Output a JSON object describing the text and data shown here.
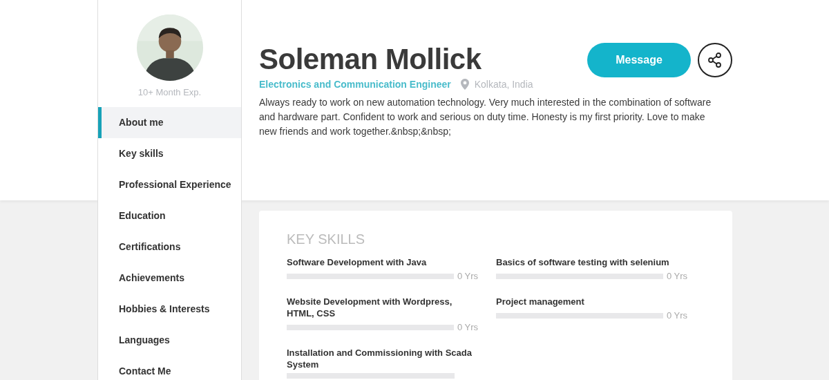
{
  "profile": {
    "experience": "10+ Month Exp.",
    "name": "Soleman Mollick",
    "title": "Electronics and Communication Engineer",
    "location": "Kolkata, India",
    "bio": "Always ready to work on new automation technology. Very much interested in the combination of software and hardware part. Confident to work and serious on duty time. Honesty is my first priority. Love to make new friends and work together.&nbsp;&nbsp;",
    "message_button": "Message"
  },
  "sidebar": {
    "items": [
      {
        "label": "About me",
        "selected": true
      },
      {
        "label": "Key skills",
        "selected": false
      },
      {
        "label": "Professional Experience",
        "selected": false
      },
      {
        "label": "Education",
        "selected": false
      },
      {
        "label": "Certifications",
        "selected": false
      },
      {
        "label": "Achievements",
        "selected": false
      },
      {
        "label": "Hobbies & Interests",
        "selected": false
      },
      {
        "label": "Languages",
        "selected": false
      },
      {
        "label": "Contact Me",
        "selected": false
      }
    ]
  },
  "key_skills": {
    "heading": "KEY SKILLS",
    "columns": [
      [
        {
          "name": "Software Development with Java",
          "level": 0,
          "reading": "0 Yrs"
        },
        {
          "name": "Website Development with Wordpress, HTML, CSS",
          "level": 0,
          "reading": "0 Yrs"
        },
        {
          "name": "Installation and Commissioning with Scada System",
          "level": 0
        }
      ],
      [
        {
          "name": "Basics of software testing with selenium",
          "level": 0,
          "reading": "0 Yrs"
        },
        {
          "name": "Project management",
          "level": 0,
          "reading": "0 Yrs"
        }
      ]
    ]
  }
}
